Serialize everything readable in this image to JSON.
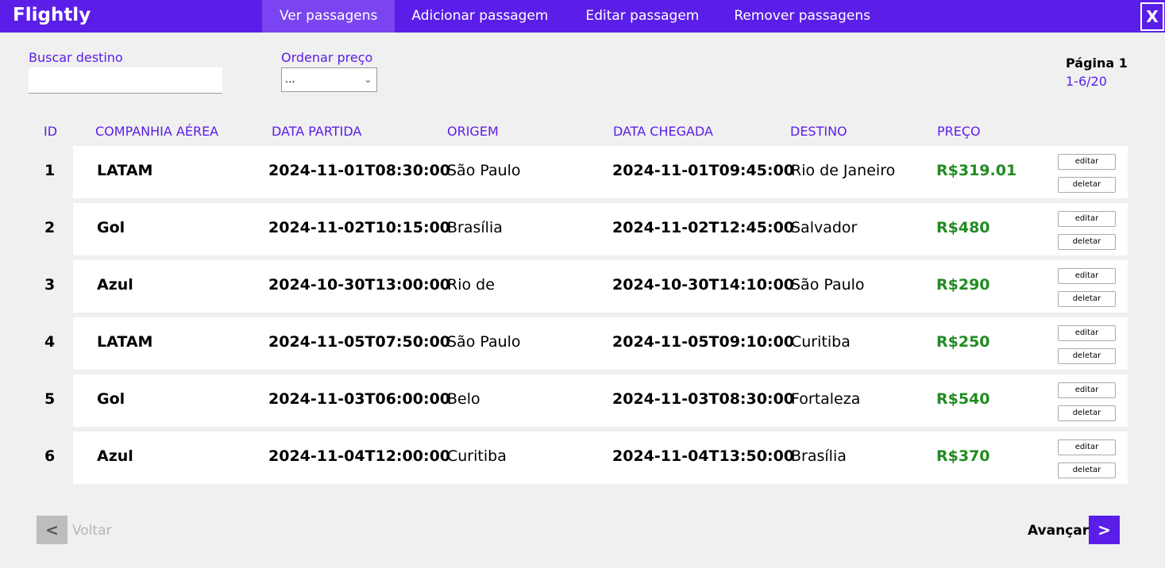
{
  "app": {
    "title": "Flightly",
    "close_label": "X"
  },
  "nav": {
    "items": [
      {
        "label": "Ver passagens",
        "active": true
      },
      {
        "label": "Adicionar passagem",
        "active": false
      },
      {
        "label": "Editar passagem",
        "active": false
      },
      {
        "label": "Remover passagens",
        "active": false
      }
    ]
  },
  "filters": {
    "search_label": "Buscar destino",
    "search_value": "",
    "sort_label": "Ordenar preço",
    "sort_selected": "..."
  },
  "pagination": {
    "page_label": "Página 1",
    "range": "1-6/20",
    "prev_label": "Voltar",
    "next_label": "Avançar",
    "prev_symbol": "<",
    "next_symbol": ">"
  },
  "table": {
    "headers": [
      "ID",
      "COMPANHIA AÉREA",
      "DATA PARTIDA",
      "ORIGEM",
      "DATA CHEGADA",
      "DESTINO",
      "PREÇO"
    ],
    "edit_label": "editar",
    "delete_label": "deletar",
    "rows": [
      {
        "id": "1",
        "airline": "LATAM",
        "departure": "2024-11-01T08:30:00",
        "origin": "São Paulo",
        "arrival": "2024-11-01T09:45:00",
        "destination": "Rio de Janeiro",
        "price": "R$319.01"
      },
      {
        "id": "2",
        "airline": "Gol",
        "departure": "2024-11-02T10:15:00",
        "origin": "Brasília",
        "arrival": "2024-11-02T12:45:00",
        "destination": "Salvador",
        "price": "R$480"
      },
      {
        "id": "3",
        "airline": "Azul",
        "departure": "2024-10-30T13:00:00",
        "origin": "Rio de",
        "arrival": "2024-10-30T14:10:00",
        "destination": "São Paulo",
        "price": "R$290"
      },
      {
        "id": "4",
        "airline": "LATAM",
        "departure": "2024-11-05T07:50:00",
        "origin": "São Paulo",
        "arrival": "2024-11-05T09:10:00",
        "destination": "Curitiba",
        "price": "R$250"
      },
      {
        "id": "5",
        "airline": "Gol",
        "departure": "2024-11-03T06:00:00",
        "origin": "Belo",
        "arrival": "2024-11-03T08:30:00",
        "destination": "Fortaleza",
        "price": "R$540"
      },
      {
        "id": "6",
        "airline": "Azul",
        "departure": "2024-11-04T12:00:00",
        "origin": "Curitiba",
        "arrival": "2024-11-04T13:50:00",
        "destination": "Brasília",
        "price": "R$370"
      }
    ]
  },
  "colors": {
    "accent": "#5b1ee8",
    "nav_active": "#7a45f0",
    "price": "#228b22",
    "background": "#f0f0f0"
  }
}
